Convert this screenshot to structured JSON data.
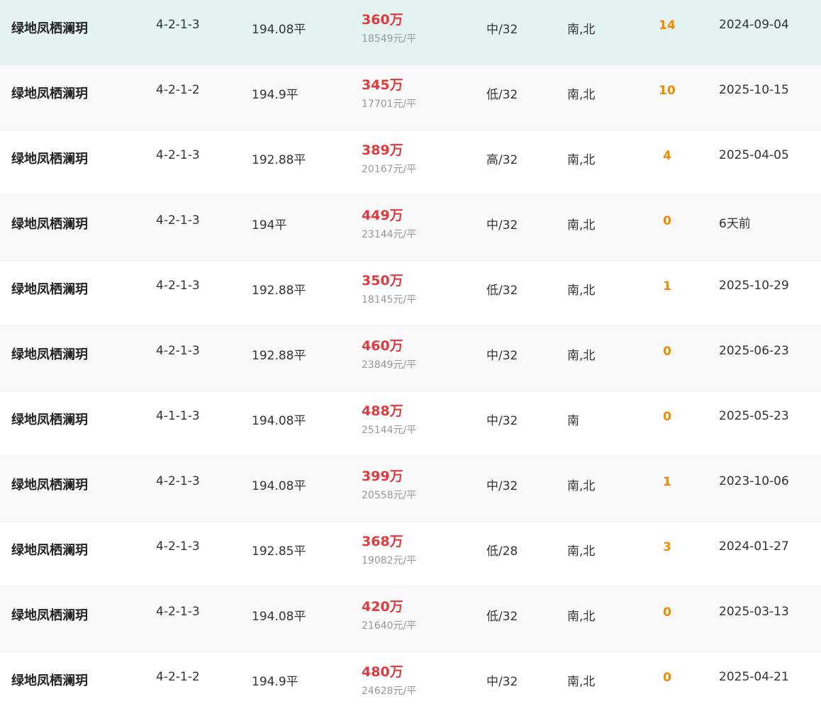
{
  "listings": [
    {
      "name": "绿地凤栖澜玥",
      "unit": "4-2-1-3",
      "area": "194.08平",
      "price": "360万",
      "unit_price": "18549元/平",
      "floor": "中/32",
      "orientation": "南,北",
      "views": "14",
      "date": "2024-09-04"
    },
    {
      "name": "绿地凤栖澜玥",
      "unit": "4-2-1-2",
      "area": "194.9平",
      "price": "345万",
      "unit_price": "17701元/平",
      "floor": "低/32",
      "orientation": "南,北",
      "views": "10",
      "date": "2025-10-15"
    },
    {
      "name": "绿地凤栖澜玥",
      "unit": "4-2-1-3",
      "area": "192.88平",
      "price": "389万",
      "unit_price": "20167元/平",
      "floor": "高/32",
      "orientation": "南,北",
      "views": "4",
      "date": "2025-04-05"
    },
    {
      "name": "绿地凤栖澜玥",
      "unit": "4-2-1-3",
      "area": "194平",
      "price": "449万",
      "unit_price": "23144元/平",
      "floor": "中/32",
      "orientation": "南,北",
      "views": "0",
      "date": "6天前"
    },
    {
      "name": "绿地凤栖澜玥",
      "unit": "4-2-1-3",
      "area": "192.88平",
      "price": "350万",
      "unit_price": "18145元/平",
      "floor": "低/32",
      "orientation": "南,北",
      "views": "1",
      "date": "2025-10-29"
    },
    {
      "name": "绿地凤栖澜玥",
      "unit": "4-2-1-3",
      "area": "192.88平",
      "price": "460万",
      "unit_price": "23849元/平",
      "floor": "中/32",
      "orientation": "南,北",
      "views": "0",
      "date": "2025-06-23"
    },
    {
      "name": "绿地凤栖澜玥",
      "unit": "4-1-1-3",
      "area": "194.08平",
      "price": "488万",
      "unit_price": "25144元/平",
      "floor": "中/32",
      "orientation": "南",
      "views": "0",
      "date": "2025-05-23"
    },
    {
      "name": "绿地凤栖澜玥",
      "unit": "4-2-1-3",
      "area": "194.08平",
      "price": "399万",
      "unit_price": "20558元/平",
      "floor": "中/32",
      "orientation": "南,北",
      "views": "1",
      "date": "2023-10-06"
    },
    {
      "name": "绿地凤栖澜玥",
      "unit": "4-2-1-3",
      "area": "192.85平",
      "price": "368万",
      "unit_price": "19082元/平",
      "floor": "低/28",
      "orientation": "南,北",
      "views": "3",
      "date": "2024-01-27"
    },
    {
      "name": "绿地凤栖澜玥",
      "unit": "4-2-1-3",
      "area": "194.08平",
      "price": "420万",
      "unit_price": "21640元/平",
      "floor": "低/32",
      "orientation": "南,北",
      "views": "0",
      "date": "2025-03-13"
    },
    {
      "name": "绿地凤栖澜玥",
      "unit": "4-2-1-2",
      "area": "194.9平",
      "price": "480万",
      "unit_price": "24628元/平",
      "floor": "中/32",
      "orientation": "南,北",
      "views": "0",
      "date": "2025-04-21"
    }
  ],
  "colors": {
    "price": "#e4393c",
    "views": "#f08a00",
    "highlight_row": "#e4f3f2",
    "alt_row": "#f9f9f9"
  }
}
